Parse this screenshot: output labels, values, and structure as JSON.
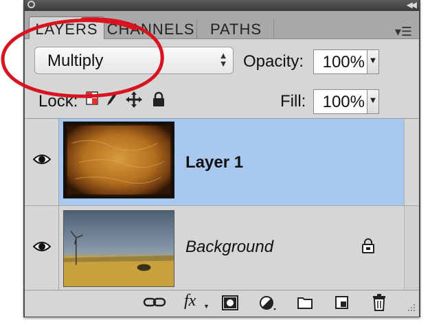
{
  "tabs": [
    {
      "label": "LAYERS",
      "active": true
    },
    {
      "label": "CHANNELS",
      "active": false
    },
    {
      "label": "PATHS",
      "active": false
    }
  ],
  "blend_mode": {
    "value": "Multiply",
    "icon": "updown-arrows-icon"
  },
  "opacity": {
    "label": "Opacity:",
    "value": "100%"
  },
  "fill": {
    "label": "Fill:",
    "value": "100%"
  },
  "lock": {
    "label": "Lock:",
    "icons": [
      "lock-transparent-icon",
      "lock-image-icon",
      "lock-position-icon",
      "lock-all-icon"
    ]
  },
  "layers": [
    {
      "name": "Layer 1",
      "visible": true,
      "selected": true
    },
    {
      "name": "Background",
      "visible": true,
      "selected": false,
      "locked": true
    }
  ],
  "bottom_icons": [
    "link-layers-icon",
    "fx-icon",
    "add-mask-icon",
    "adjustment-layer-icon",
    "new-group-icon",
    "new-layer-icon",
    "delete-layer-icon"
  ],
  "fx_label": "fx",
  "colors": {
    "selection": "#a9c8ef",
    "panel": "#d6d6d6",
    "annotation": "#d7141f"
  }
}
